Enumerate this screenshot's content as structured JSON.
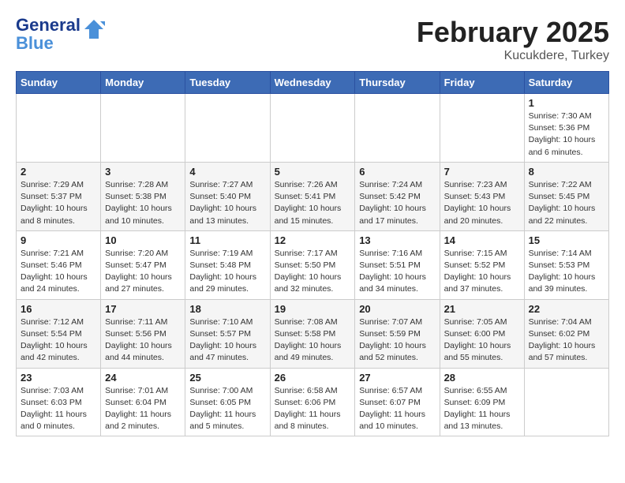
{
  "header": {
    "logo_line1": "General",
    "logo_line2": "Blue",
    "month": "February 2025",
    "location": "Kucukdere, Turkey"
  },
  "days_of_week": [
    "Sunday",
    "Monday",
    "Tuesday",
    "Wednesday",
    "Thursday",
    "Friday",
    "Saturday"
  ],
  "weeks": [
    [
      {
        "day": "",
        "info": ""
      },
      {
        "day": "",
        "info": ""
      },
      {
        "day": "",
        "info": ""
      },
      {
        "day": "",
        "info": ""
      },
      {
        "day": "",
        "info": ""
      },
      {
        "day": "",
        "info": ""
      },
      {
        "day": "1",
        "info": "Sunrise: 7:30 AM\nSunset: 5:36 PM\nDaylight: 10 hours and 6 minutes."
      }
    ],
    [
      {
        "day": "2",
        "info": "Sunrise: 7:29 AM\nSunset: 5:37 PM\nDaylight: 10 hours and 8 minutes."
      },
      {
        "day": "3",
        "info": "Sunrise: 7:28 AM\nSunset: 5:38 PM\nDaylight: 10 hours and 10 minutes."
      },
      {
        "day": "4",
        "info": "Sunrise: 7:27 AM\nSunset: 5:40 PM\nDaylight: 10 hours and 13 minutes."
      },
      {
        "day": "5",
        "info": "Sunrise: 7:26 AM\nSunset: 5:41 PM\nDaylight: 10 hours and 15 minutes."
      },
      {
        "day": "6",
        "info": "Sunrise: 7:24 AM\nSunset: 5:42 PM\nDaylight: 10 hours and 17 minutes."
      },
      {
        "day": "7",
        "info": "Sunrise: 7:23 AM\nSunset: 5:43 PM\nDaylight: 10 hours and 20 minutes."
      },
      {
        "day": "8",
        "info": "Sunrise: 7:22 AM\nSunset: 5:45 PM\nDaylight: 10 hours and 22 minutes."
      }
    ],
    [
      {
        "day": "9",
        "info": "Sunrise: 7:21 AM\nSunset: 5:46 PM\nDaylight: 10 hours and 24 minutes."
      },
      {
        "day": "10",
        "info": "Sunrise: 7:20 AM\nSunset: 5:47 PM\nDaylight: 10 hours and 27 minutes."
      },
      {
        "day": "11",
        "info": "Sunrise: 7:19 AM\nSunset: 5:48 PM\nDaylight: 10 hours and 29 minutes."
      },
      {
        "day": "12",
        "info": "Sunrise: 7:17 AM\nSunset: 5:50 PM\nDaylight: 10 hours and 32 minutes."
      },
      {
        "day": "13",
        "info": "Sunrise: 7:16 AM\nSunset: 5:51 PM\nDaylight: 10 hours and 34 minutes."
      },
      {
        "day": "14",
        "info": "Sunrise: 7:15 AM\nSunset: 5:52 PM\nDaylight: 10 hours and 37 minutes."
      },
      {
        "day": "15",
        "info": "Sunrise: 7:14 AM\nSunset: 5:53 PM\nDaylight: 10 hours and 39 minutes."
      }
    ],
    [
      {
        "day": "16",
        "info": "Sunrise: 7:12 AM\nSunset: 5:54 PM\nDaylight: 10 hours and 42 minutes."
      },
      {
        "day": "17",
        "info": "Sunrise: 7:11 AM\nSunset: 5:56 PM\nDaylight: 10 hours and 44 minutes."
      },
      {
        "day": "18",
        "info": "Sunrise: 7:10 AM\nSunset: 5:57 PM\nDaylight: 10 hours and 47 minutes."
      },
      {
        "day": "19",
        "info": "Sunrise: 7:08 AM\nSunset: 5:58 PM\nDaylight: 10 hours and 49 minutes."
      },
      {
        "day": "20",
        "info": "Sunrise: 7:07 AM\nSunset: 5:59 PM\nDaylight: 10 hours and 52 minutes."
      },
      {
        "day": "21",
        "info": "Sunrise: 7:05 AM\nSunset: 6:00 PM\nDaylight: 10 hours and 55 minutes."
      },
      {
        "day": "22",
        "info": "Sunrise: 7:04 AM\nSunset: 6:02 PM\nDaylight: 10 hours and 57 minutes."
      }
    ],
    [
      {
        "day": "23",
        "info": "Sunrise: 7:03 AM\nSunset: 6:03 PM\nDaylight: 11 hours and 0 minutes."
      },
      {
        "day": "24",
        "info": "Sunrise: 7:01 AM\nSunset: 6:04 PM\nDaylight: 11 hours and 2 minutes."
      },
      {
        "day": "25",
        "info": "Sunrise: 7:00 AM\nSunset: 6:05 PM\nDaylight: 11 hours and 5 minutes."
      },
      {
        "day": "26",
        "info": "Sunrise: 6:58 AM\nSunset: 6:06 PM\nDaylight: 11 hours and 8 minutes."
      },
      {
        "day": "27",
        "info": "Sunrise: 6:57 AM\nSunset: 6:07 PM\nDaylight: 11 hours and 10 minutes."
      },
      {
        "day": "28",
        "info": "Sunrise: 6:55 AM\nSunset: 6:09 PM\nDaylight: 11 hours and 13 minutes."
      },
      {
        "day": "",
        "info": ""
      }
    ]
  ]
}
